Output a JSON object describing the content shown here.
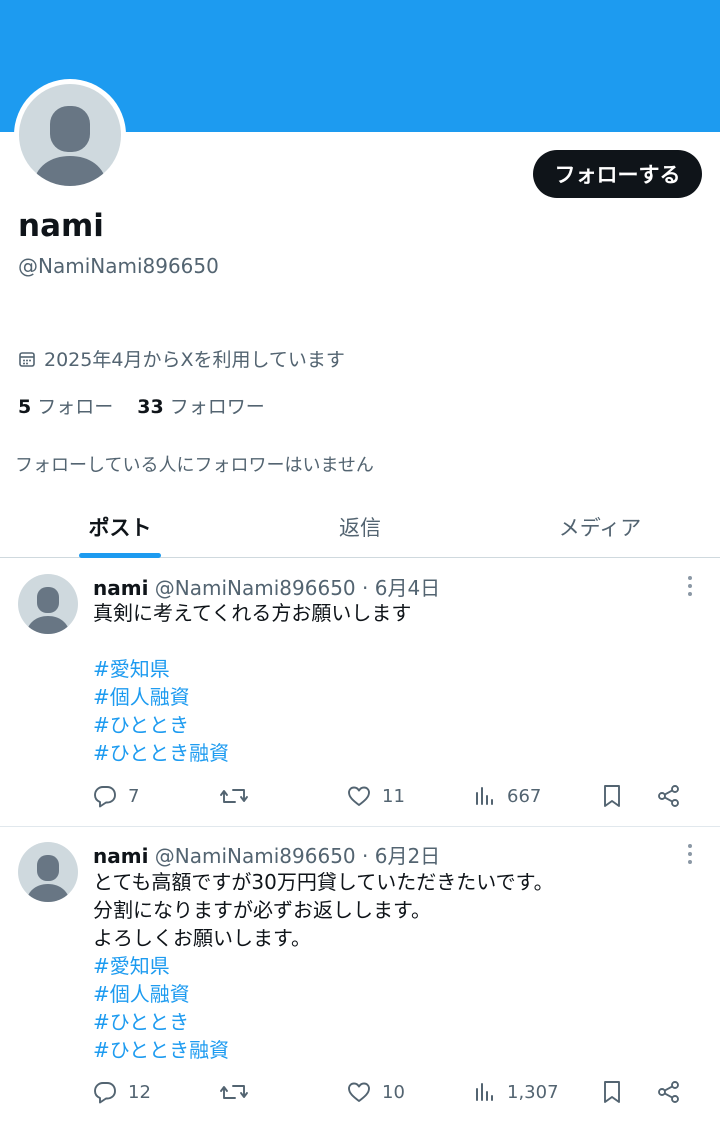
{
  "colors": {
    "banner": "#1d9bf0",
    "accent": "#1d9bf0",
    "text": "#0f1419",
    "muted": "#536471"
  },
  "profile": {
    "follow_label": "フォローする",
    "display_name": "nami",
    "handle": "@NamiNami896650",
    "joined": "2025年4月からXを利用しています",
    "following_count": "5",
    "following_label": "フォロー",
    "followers_count": "33",
    "followers_label": "フォロワー",
    "no_mutual_followers": "フォローしている人にフォロワーはいません"
  },
  "tabs": [
    {
      "label": "ポスト",
      "active": true
    },
    {
      "label": "返信",
      "active": false
    },
    {
      "label": "メディア",
      "active": false
    }
  ],
  "posts": [
    {
      "name": "nami",
      "handle": "@NamiNami896650",
      "date": "· 6月4日",
      "text_lines": [
        "真剣に考えてくれる方お願いします"
      ],
      "tags": [
        "#愛知県",
        "#個人融資",
        "#ひととき",
        "#ひととき融資"
      ],
      "replies": "7",
      "likes": "11",
      "views": "667"
    },
    {
      "name": "nami",
      "handle": "@NamiNami896650",
      "date": "· 6月2日",
      "text_lines": [
        "とても高額ですが30万円貸していただきたいです。",
        "分割になりますが必ずお返しします。",
        "よろしくお願いします。"
      ],
      "tags": [
        "#愛知県",
        "#個人融資",
        "#ひととき",
        "#ひととき融資"
      ],
      "replies": "12",
      "likes": "10",
      "views": "1,307"
    }
  ]
}
